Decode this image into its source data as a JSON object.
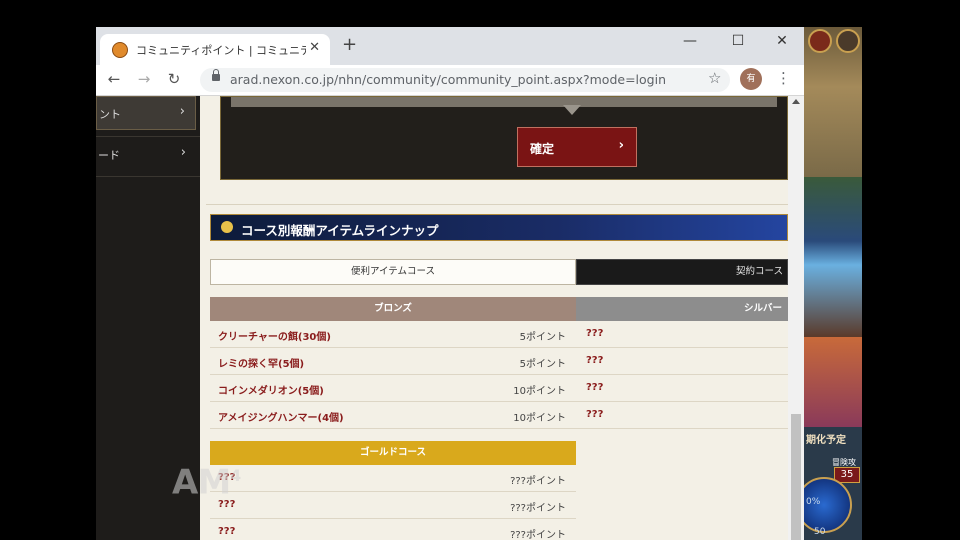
{
  "browser": {
    "tab_title": "コミュニティポイント | コミュニティ | アラ",
    "tab_close": "✕",
    "new_tab": "+",
    "minimize": "—",
    "maximize": "☐",
    "close": "✕",
    "back": "←",
    "forward": "→",
    "reload": "↻",
    "url": "arad.nexon.co.jp/nhn/community/community_point.aspx?mode=login",
    "star": "☆",
    "menu": "⋮",
    "avatar_label": "有"
  },
  "sidebar": {
    "items": [
      {
        "label": "ント",
        "arrow": "›"
      },
      {
        "label": "ード",
        "arrow": "›"
      }
    ]
  },
  "confirm": {
    "label": "確定",
    "arrow": "›"
  },
  "section": {
    "title": "コース別報酬アイテムラインナップ"
  },
  "course_tabs": {
    "left": "便利アイテムコース",
    "right": "契約コース"
  },
  "tiers": {
    "bronze": "ブロンズ",
    "silver": "シルバー",
    "gold": "ゴールドコース"
  },
  "bronze_rows": [
    {
      "item": "クリーチャーの餌(30個)",
      "points": "5ポイント",
      "silver": "???"
    },
    {
      "item": "レミの探く罕(5個)",
      "points": "5ポイント",
      "silver": "???"
    },
    {
      "item": "コインメダリオン(5個)",
      "points": "10ポイント",
      "silver": "???"
    },
    {
      "item": "アメイジングハンマー(4個)",
      "points": "10ポイント",
      "silver": "???"
    }
  ],
  "gold_rows": [
    {
      "item": "???",
      "points": "???ポイント"
    },
    {
      "item": "???",
      "points": "???ポイント"
    },
    {
      "item": "???",
      "points": "???ポイント"
    }
  ],
  "watermark": {
    "text": "AM",
    "sup": "4"
  },
  "game": {
    "text1": "期化予定",
    "text2": "冒険攻",
    "badge": "35",
    "percent": "0%",
    "number": "50"
  }
}
